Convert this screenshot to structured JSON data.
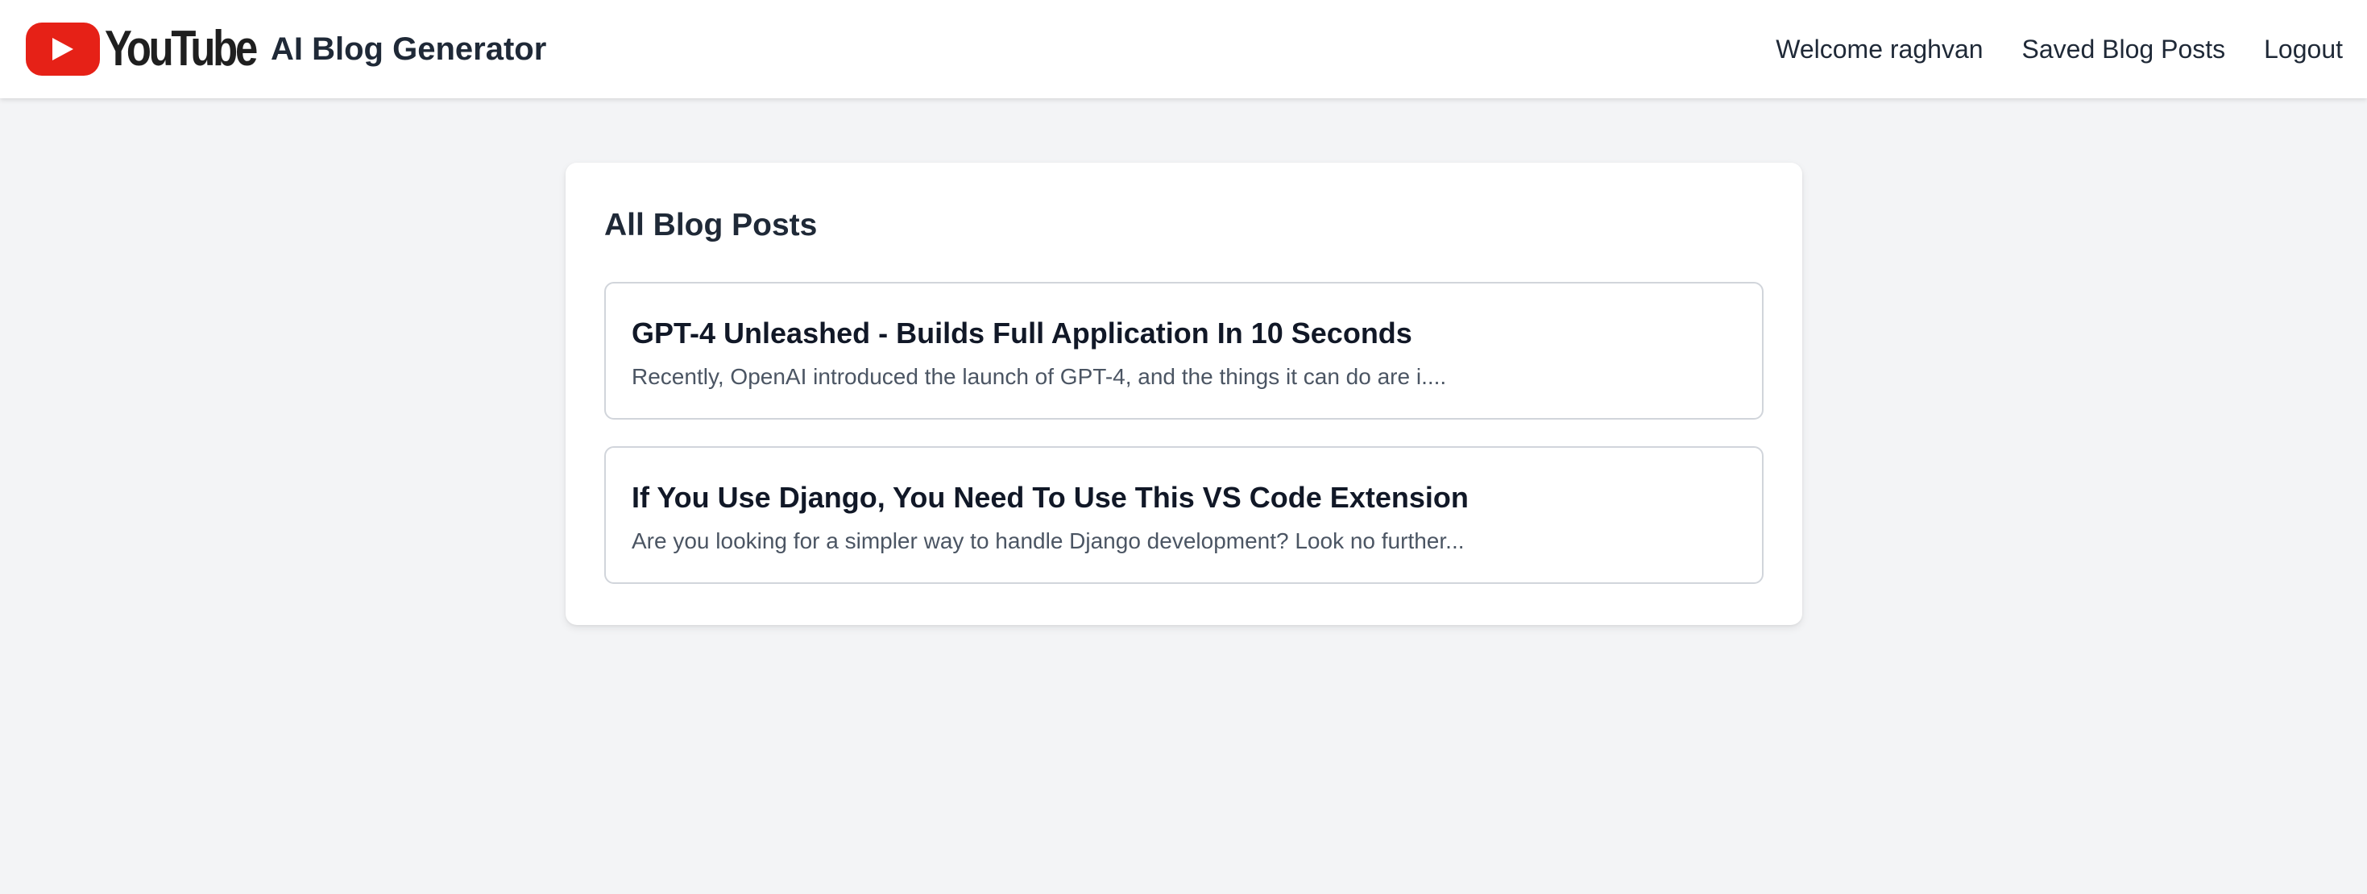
{
  "header": {
    "logo_text": "YouTube",
    "app_title": "AI Blog Generator",
    "welcome": "Welcome raghvan",
    "saved_posts_link": "Saved Blog Posts",
    "logout_link": "Logout"
  },
  "main": {
    "title": "All Blog Posts",
    "posts": [
      {
        "title": "GPT-4 Unleashed - Builds Full Application In 10 Seconds",
        "excerpt": "Recently, OpenAI introduced the launch of GPT-4, and the things it can do are i...."
      },
      {
        "title": "If You Use Django, You Need To Use This VS Code Extension",
        "excerpt": "Are you looking for a simpler way to handle Django development? Look no further..."
      }
    ]
  },
  "colors": {
    "youtube_red": "#e62117",
    "page_background": "#f3f4f6",
    "card_background": "#ffffff",
    "text_primary": "#111827",
    "text_secondary": "#4b5563",
    "border": "#d1d5db"
  },
  "icons": {
    "logo": "youtube-logo-icon",
    "play": "play-icon"
  }
}
